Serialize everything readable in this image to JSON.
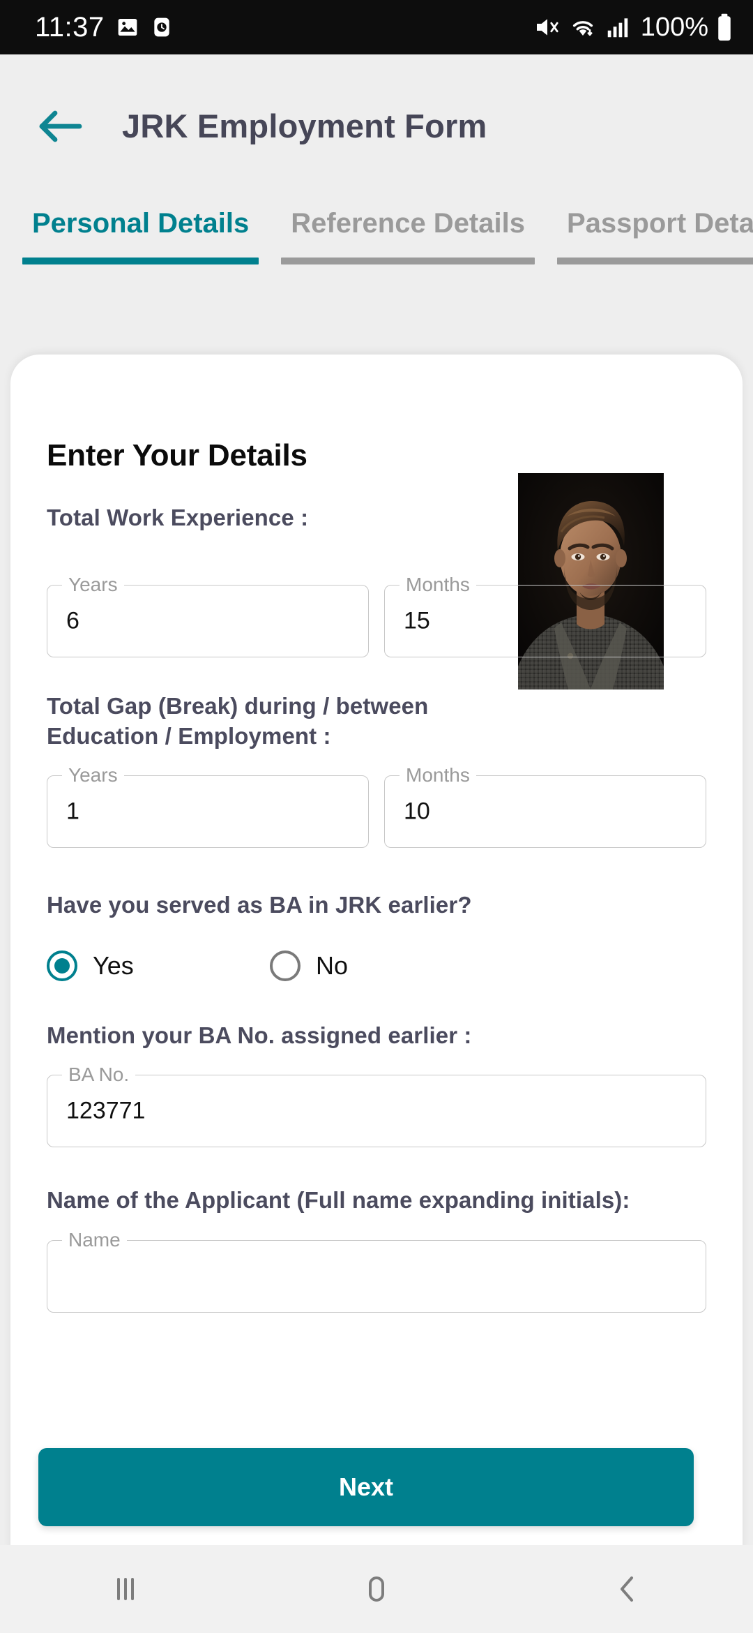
{
  "status_bar": {
    "time": "11:37",
    "battery_percent": "100%",
    "icons": [
      "image-icon",
      "clock-icon",
      "mute-icon",
      "wifi-icon",
      "signal-icon",
      "battery-icon"
    ]
  },
  "app_bar": {
    "title": "JRK Employment Form",
    "back_icon": "back-arrow-icon"
  },
  "tabs": [
    {
      "label": "Personal Details",
      "active": true
    },
    {
      "label": "Reference Details",
      "active": false
    },
    {
      "label": "Passport Detail",
      "active": false
    }
  ],
  "form": {
    "heading": "Enter Your Details",
    "photo_alt": "applicant-photo",
    "work_experience": {
      "label": "Total Work Experience :",
      "years": {
        "placeholder": "Years",
        "value": "6"
      },
      "months": {
        "placeholder": "Months",
        "value": "15"
      }
    },
    "gap": {
      "label": "Total Gap (Break) during / between Education / Employment :",
      "years": {
        "placeholder": "Years",
        "value": "1"
      },
      "months": {
        "placeholder": "Months",
        "value": "10"
      }
    },
    "served_ba": {
      "label": "Have you served as BA in JRK earlier?",
      "options": [
        {
          "label": "Yes",
          "selected": true
        },
        {
          "label": "No",
          "selected": false
        }
      ]
    },
    "ba_no": {
      "label": "Mention your BA No. assigned earlier :",
      "field": {
        "placeholder": "BA No.",
        "value": "123771"
      }
    },
    "applicant_name": {
      "label": "Name of the Applicant (Full name expanding initials):",
      "field": {
        "placeholder": "Name",
        "value": ""
      }
    }
  },
  "next_button": {
    "label": "Next"
  },
  "nav_bar": {
    "recents_icon": "recents-icon",
    "home_icon": "home-icon",
    "back_icon": "nav-back-icon"
  },
  "colors": {
    "accent": "#00808e",
    "heading": "#4b4b5e",
    "inactive_tab": "#9a9a9a",
    "page_bg": "#eeeeee"
  }
}
